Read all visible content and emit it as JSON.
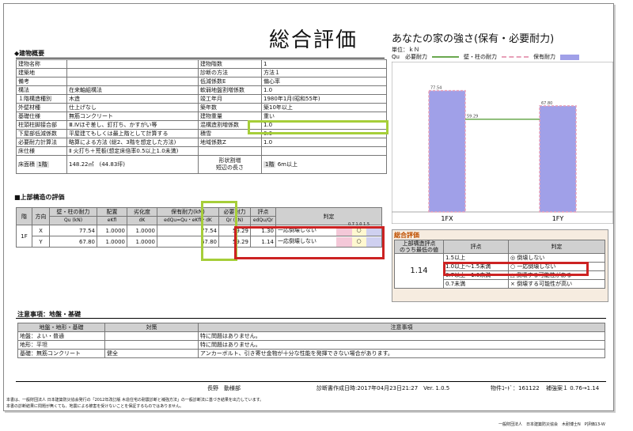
{
  "title": "総合評価",
  "subtitle": "あなたの家の強さ(保有・必要耐力)",
  "building": {
    "heading": "◆建物概要",
    "left": [
      [
        "建物名称",
        ""
      ],
      [
        "建築地",
        ""
      ],
      [
        "備考",
        ""
      ],
      [
        "構法",
        "在来軸組構法"
      ],
      [
        "１階構造種別",
        "木造"
      ],
      [
        "外壁材種",
        "仕上げなし"
      ],
      [
        "基礎仕様",
        "無筋コンクリート"
      ],
      [
        "柱頭柱脚接合部",
        "Ⅲ.Ⅳほぞ差し、釘打ち、かすがい等"
      ],
      [
        "下屋部低減係数",
        "平屋建てもしくは最上階として計算する"
      ],
      [
        "必要耐力計算法",
        "略算による方法 (総2、3階を想定した方法)"
      ],
      [
        "床仕様",
        "Ⅱ 火打ち＋荒板(想定床倍率0.5以上1.0未満)"
      ]
    ],
    "right": [
      [
        "建物階数",
        "1"
      ],
      [
        "診断の方法",
        "方法１"
      ],
      [
        "低減係数E",
        "偏心率"
      ],
      [
        "軟弱地盤割増係数",
        "1.0"
      ],
      [
        "竣工年月",
        "1980年1月(昭和55年)"
      ],
      [
        "築年数",
        "築10年以上"
      ],
      [
        "建物重量",
        "重い"
      ],
      [
        "混構造割増係数",
        "1.0"
      ],
      [
        "積雪",
        "0.0"
      ],
      [
        "地域係数Z",
        "1.0"
      ]
    ],
    "floor_area_label": "床面積",
    "floor_label": "1階",
    "floor_area": "148.22㎡",
    "floor_tsubo": "(44.83坪)",
    "short_side_label1": "形状割増",
    "short_side_label2": "短辺の長さ",
    "short_side_floor": "1階",
    "short_side_value": "6m以上"
  },
  "upper": {
    "heading": "■上部構造の評価",
    "headers": [
      "階",
      "方向",
      "壁・柱の耐力",
      "配置",
      "劣化度",
      "保有耐力(kN)",
      "必要耐力",
      "評点",
      "判定"
    ],
    "subheaders": [
      "",
      "",
      "Qu (kN)",
      "eKfl",
      "dK",
      "edQu=Qu・eKfl・dK",
      "Qr (kN)",
      "edQu/Qr",
      ""
    ],
    "floor": "1F",
    "rows": [
      {
        "dir": "X",
        "qu": "77.54",
        "ekfl": "1.0000",
        "dk": "1.0000",
        "edqu": "77.54",
        "qr": "59.29",
        "score": "1.30",
        "judge": "一応倒壊しない",
        "mark": "○"
      },
      {
        "dir": "Y",
        "qu": "67.80",
        "ekfl": "1.0000",
        "dk": "1.0000",
        "edqu": "67.80",
        "qr": "59.29",
        "score": "1.14",
        "judge": "一応倒壊しない",
        "mark": "○"
      }
    ],
    "scale_small": "0.7 1.0  1.5"
  },
  "chart_data": {
    "type": "bar",
    "unit_label": "単位：ｋＮ",
    "legend": [
      {
        "name": "Qu　必要耐力",
        "color": "#6aa84f"
      },
      {
        "name": "壁・柱の耐力",
        "color": "#e8a0b8"
      },
      {
        "name": "保有耐力",
        "color": "#a0a0e8"
      }
    ],
    "categories": [
      "1FX",
      "1FY"
    ],
    "series": [
      {
        "name": "壁・柱の耐力",
        "values": [
          77.54,
          67.8
        ]
      },
      {
        "name": "保有耐力",
        "values": [
          77.54,
          67.8
        ]
      },
      {
        "name": "必要耐力",
        "values": [
          59.29,
          59.29
        ]
      }
    ],
    "value_labels": [
      "77.54",
      "67.80",
      "59.29"
    ],
    "ylim": [
      0,
      90
    ]
  },
  "overall": {
    "heading": "総合評価",
    "left_header1": "上部構造評点",
    "left_header2": "のうち最低の値",
    "value": "1.14",
    "col_score": "評点",
    "col_judge": "判定",
    "rows": [
      {
        "score": "1.5以上",
        "judge": "◎ 倒壊しない"
      },
      {
        "score": "1.0以上～1.5未満",
        "judge": "○ 一応倒壊しない"
      },
      {
        "score": "0.7以上～1.0未満",
        "judge": "△ 倒壊する可能性がある"
      },
      {
        "score": "0.7未満",
        "judge": "× 倒壊する可能性が高い"
      }
    ]
  },
  "notes": {
    "heading": "注意事項：地盤・基礎",
    "headers": [
      "地盤・地形・基礎",
      "対策",
      "注意事項"
    ],
    "rows": [
      [
        "地盤：よい・普通",
        "",
        "特に問題はありません。"
      ],
      [
        "地形：平坦",
        "",
        "特に問題はありません。"
      ],
      [
        "基礎：無筋コンクリート",
        "健全",
        "アンカーボルト、引き寄せ金物が十分な性能を発揮できない場合があります。"
      ]
    ]
  },
  "footer": {
    "place": "長野　動様部",
    "datetime": "診断書作成日時:2017年04月23日21:27　Ver. 1.0.5",
    "code": "物件ｺｰﾄﾞ：161122",
    "reinforce": "補強案１ 0.76→1.14",
    "note1": "本書は、一般財団法人 日本建築防災協会発行の「2012年改訂版 木造住宅の耐震診断と補強方法」の一般診断法に基づき結果を出力しています。",
    "note2": "本書の診断結果に問題が無くても、地震による被害を受けないことを保証するものではありません。",
    "publisher": "一般財団法人　日本建築防災協会　木耐博士N　P評価13-Ｗ"
  }
}
